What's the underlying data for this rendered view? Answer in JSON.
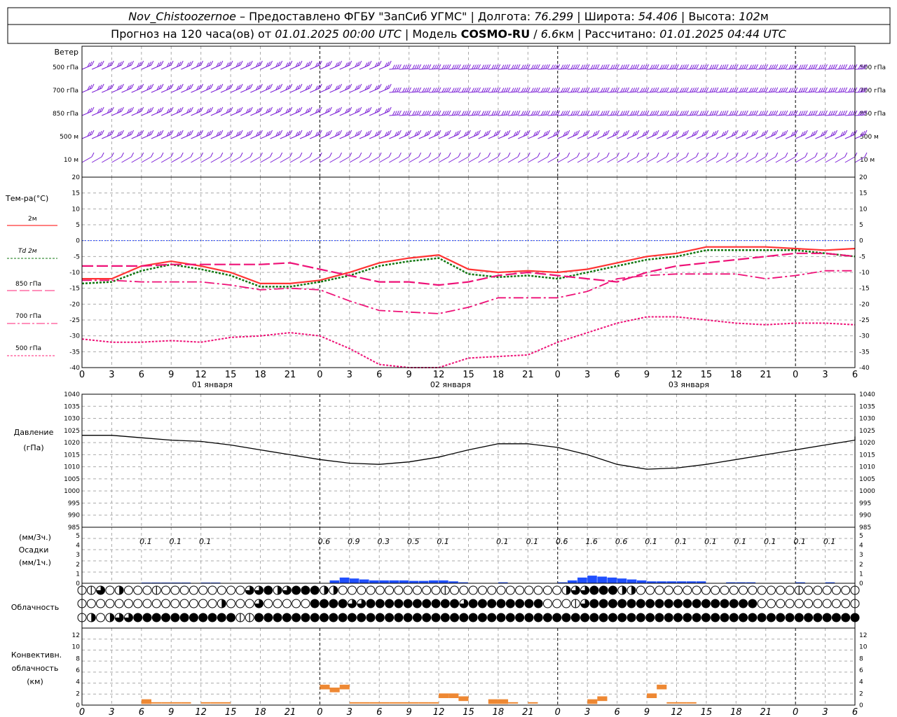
{
  "header": {
    "station": "Nov_Chistoozernoe",
    "provider": " – Предоставлено ФГБУ \"ЗапСиб УГМС\" | Долгота: ",
    "lon": "76.299",
    "lat_label": " | Широта: ",
    "lat": "54.406",
    "alt_label": " | Высота: ",
    "alt": "102",
    "alt_unit": "м",
    "line2_a": "Прогноз на 120 часа(ов) от ",
    "init_time": "01.01.2025 00:00 UTC",
    "line2_b": "  | Модель ",
    "model": "COSMO-RU",
    "line2_c": " / ",
    "resolution": "6.6",
    "res_unit": "км",
    "line2_d": " | Рассчитано: ",
    "calc_time": "01.01.2025 04:44 UTC"
  },
  "wind_panel": {
    "title": "Ветер",
    "levels": [
      "500 гПа",
      "700 гПа",
      "850 гПа",
      "500 м",
      "10  м"
    ],
    "barb_color": "#7b1fd6",
    "top_color": "#5b0fb8"
  },
  "temp_panel": {
    "title": "Тем-ра(°С)",
    "legend": [
      {
        "label": "2м",
        "color": "#ff0000"
      },
      {
        "label": "Td  2м",
        "color": "#117711"
      },
      {
        "label": "850 гПа",
        "color": "#ff2277"
      },
      {
        "label": "700 гПа",
        "color": "#ff2277"
      },
      {
        "label": "500 гПа",
        "color": "#ff2277"
      }
    ],
    "ticks": [
      "20",
      "15",
      "10",
      "5",
      "0",
      "-5",
      "-10",
      "-15",
      "-20",
      "-25",
      "-30",
      "-35",
      "-40"
    ],
    "zero_line_color": "#1f3fff"
  },
  "time_axis": {
    "hours": [
      "0",
      "3",
      "6",
      "9",
      "12",
      "15",
      "18",
      "21",
      "0",
      "3",
      "6",
      "9",
      "12",
      "15",
      "18",
      "21",
      "0",
      "3",
      "6",
      "9",
      "12",
      "15",
      "18",
      "21",
      "0",
      "3",
      "6"
    ],
    "days": [
      "01 января",
      "02 января",
      "03 января"
    ]
  },
  "pressure_panel": {
    "title": "Давление",
    "unit": "(гПа)",
    "ticks": [
      "1040",
      "1035",
      "1030",
      "1025",
      "1020",
      "1015",
      "1010",
      "1005",
      "1000",
      "995",
      "990",
      "985"
    ]
  },
  "precip_panel": {
    "unit_top": "(мм/3ч.)",
    "title": "Осадки",
    "unit_bottom": "(мм/1ч.)",
    "ticks": [
      "5",
      "4",
      "3",
      "2",
      "1",
      "0"
    ],
    "bar_color": "#1f4fff",
    "sums": [
      "0.1",
      "0.1",
      "0.1",
      "0.6",
      "0.9",
      "0.3",
      "0.5",
      "0.1",
      "0.1",
      "0.1",
      "0.6",
      "1.6",
      "0.6",
      "0.1",
      "0.1",
      "0.1",
      "0.1",
      "0.1",
      "0.1",
      "0.1"
    ]
  },
  "cloud_panel": {
    "title": "Облачность"
  },
  "conv_panel": {
    "title_1": "Конвективн.",
    "title_2": "облачность",
    "unit": "(км)",
    "ticks": [
      "12",
      "10",
      "8",
      "6",
      "4",
      "2",
      "0"
    ],
    "bar_color": "#ee8833"
  },
  "chart_data": [
    {
      "type": "line",
      "title": "Тем-ра(°С)",
      "x_hours": [
        0,
        3,
        6,
        9,
        12,
        15,
        18,
        21,
        24,
        27,
        30,
        33,
        36,
        39,
        42,
        45,
        48,
        51,
        54,
        57,
        60,
        63,
        66,
        69,
        72,
        75,
        78
      ],
      "ylim": [
        -40,
        20
      ],
      "series": [
        {
          "name": "2м",
          "values": [
            -12,
            -12,
            -8,
            -6.5,
            -8,
            -10,
            -13.5,
            -13.5,
            -12.5,
            -10,
            -7,
            -5.5,
            -4.5,
            -9,
            -10,
            -9.5,
            -10,
            -9,
            -7,
            -5,
            -4,
            -2,
            -2,
            -2,
            -2.5,
            -3,
            -2.5
          ]
        },
        {
          "name": "Td  2м",
          "values": [
            -13.5,
            -13,
            -9.5,
            -7.5,
            -9,
            -11,
            -14.5,
            -14.5,
            -13,
            -11,
            -8,
            -6.5,
            -5.5,
            -10.5,
            -11.5,
            -11,
            -12,
            -10,
            -8,
            -6,
            -5,
            -3,
            -3,
            -3,
            -3,
            -4,
            -5
          ]
        },
        {
          "name": "850 гПа",
          "values": [
            -8,
            -8,
            -8,
            -7.5,
            -7.5,
            -7.5,
            -7.5,
            -7,
            -9,
            -11,
            -13,
            -13,
            -14,
            -13,
            -11,
            -10,
            -11,
            -12,
            -13,
            -10,
            -8,
            -7,
            -6,
            -5,
            -4,
            -4,
            -5
          ]
        },
        {
          "name": "700 гПа",
          "values": [
            -12.5,
            -12.5,
            -13,
            -13,
            -13,
            -14,
            -15.5,
            -15,
            -15.5,
            -19,
            -22,
            -22.5,
            -23,
            -21,
            -18,
            -18,
            -18,
            -16,
            -12,
            -11,
            -10.5,
            -10.5,
            -10.5,
            -12,
            -11,
            -9.5,
            -9.5
          ]
        },
        {
          "name": "500 гПа",
          "values": [
            -31,
            -32,
            -32,
            -31.5,
            -32,
            -30.5,
            -30,
            -29,
            -30,
            -34,
            -39,
            -44,
            -40,
            -37,
            -36.5,
            -36,
            -32,
            -29,
            -26,
            -24,
            -24,
            -25,
            -26,
            -26.5,
            -26,
            -26,
            -26.5
          ]
        }
      ]
    },
    {
      "type": "line",
      "title": "Давление",
      "x_hours": [
        0,
        3,
        6,
        9,
        12,
        15,
        18,
        21,
        24,
        27,
        30,
        33,
        36,
        39,
        42,
        45,
        48,
        51,
        54,
        57,
        60,
        63,
        66,
        69,
        72,
        75,
        78
      ],
      "ylim": [
        985,
        1040
      ],
      "series": [
        {
          "name": "",
          "values": [
            1023,
            1023,
            1022,
            1021,
            1020.5,
            1019,
            1017,
            1015,
            1013,
            1011.5,
            1011,
            1012,
            1014,
            1017,
            1019.5,
            1019.5,
            1018,
            1015,
            1011,
            1009,
            1009.5,
            1011,
            1013,
            1015,
            1017,
            1019,
            1021,
            1022.5
          ]
        }
      ]
    },
    {
      "type": "bar",
      "title": "Осадки",
      "x_hours": [
        6,
        7,
        8,
        9,
        10,
        12,
        13,
        25,
        26,
        27,
        28,
        29,
        30,
        31,
        32,
        33,
        34,
        35,
        36,
        37,
        38,
        42,
        48,
        49,
        50,
        51,
        52,
        53,
        54,
        55,
        56,
        57,
        58,
        59,
        60,
        61,
        62,
        65,
        66,
        67,
        72,
        75
      ],
      "values": [
        0.05,
        0.05,
        0.05,
        0.05,
        0.05,
        0.05,
        0.05,
        0.3,
        0.6,
        0.5,
        0.4,
        0.3,
        0.3,
        0.3,
        0.3,
        0.25,
        0.25,
        0.3,
        0.3,
        0.2,
        0.1,
        0.1,
        0.1,
        0.3,
        0.6,
        0.8,
        0.7,
        0.6,
        0.5,
        0.4,
        0.3,
        0.2,
        0.2,
        0.2,
        0.2,
        0.2,
        0.2,
        0.1,
        0.1,
        0.1,
        0.1,
        0.1
      ],
      "ylim": [
        0,
        5
      ]
    },
    {
      "type": "bar",
      "title": "Конвективн. облачность",
      "x_hours": [
        6,
        7,
        8,
        9,
        10,
        12,
        13,
        14,
        24,
        25,
        26,
        27,
        28,
        29,
        30,
        31,
        32,
        33,
        34,
        35,
        36,
        37,
        38,
        41,
        42,
        43,
        45,
        51,
        52,
        57,
        58,
        59,
        60,
        61
      ],
      "values": [
        1,
        0.5,
        0.5,
        0.5,
        0.5,
        0.5,
        0.5,
        0.5,
        3.5,
        3,
        3.5,
        0.5,
        0.5,
        0.5,
        0.5,
        0.5,
        0.5,
        0.5,
        0.5,
        0.5,
        2,
        2,
        1.5,
        1,
        1,
        0.5,
        0.5,
        1,
        1.5,
        2,
        3.5,
        0.5,
        0.5,
        0.5
      ],
      "ylim": [
        0,
        13
      ]
    }
  ],
  "clouds": {
    "top": "013020001000000000334234442200000000000100000000000023344422000000000000000001000000",
    "mid": "000000000000000200030000044443344444444443444444440001344444444444444444400000000000",
    "low": "020233444444444441144444444444444444444444444444444444444444444444444444444444444444"
  }
}
